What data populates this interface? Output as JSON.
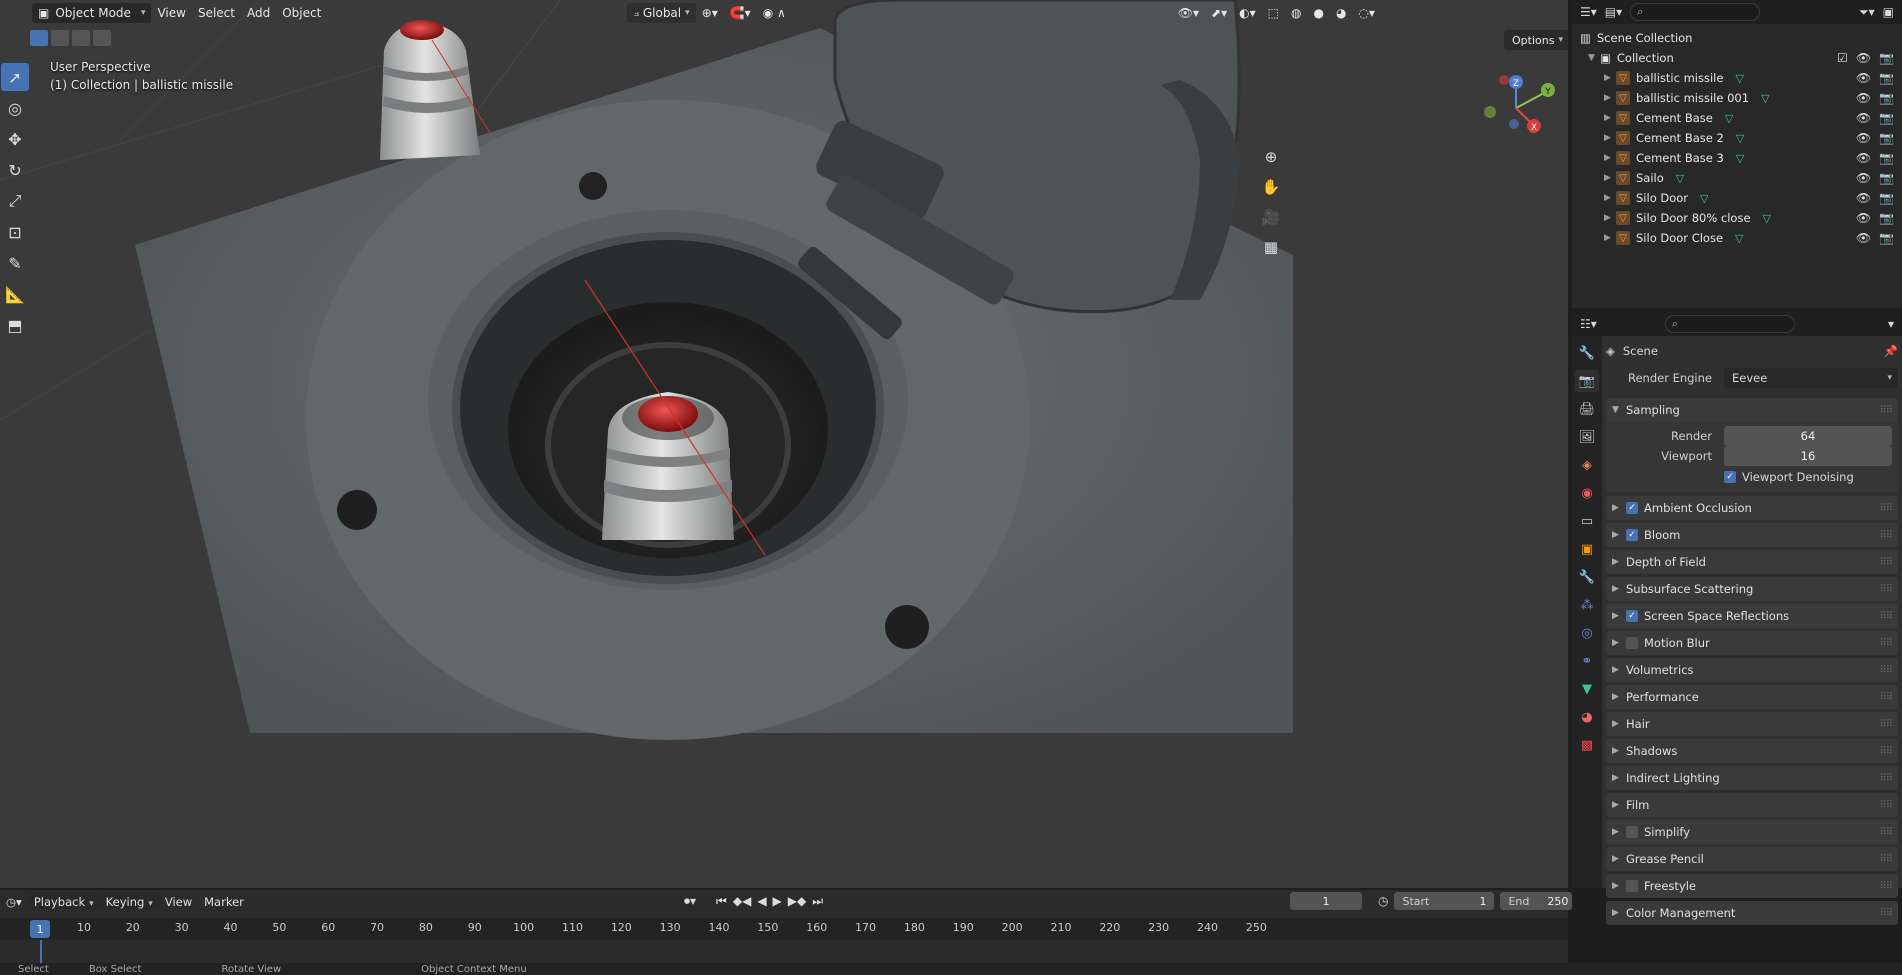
{
  "viewport_header": {
    "mode": "Object Mode",
    "menus": [
      "View",
      "Select",
      "Add",
      "Object"
    ],
    "orientation": "Global",
    "options_label": "Options"
  },
  "viewport_overlay": {
    "perspective": "User Perspective",
    "collection_info": "(1) Collection | ballistic missile"
  },
  "gizmo": {
    "x": "X",
    "y": "Y",
    "z": "Z"
  },
  "outliner": {
    "scene_collection": "Scene Collection",
    "collection": "Collection",
    "items": [
      "ballistic missile",
      "ballistic missile 001",
      "Cement  Base",
      "Cement  Base 2",
      "Cement  Base 3",
      "Sailo",
      "Silo Door",
      "Silo Door 80% close",
      "Silo Door Close"
    ]
  },
  "properties": {
    "context": "Scene",
    "render_engine_label": "Render Engine",
    "render_engine_value": "Eevee",
    "sampling": {
      "title": "Sampling",
      "render_label": "Render",
      "render_value": "64",
      "viewport_label": "Viewport",
      "viewport_value": "16",
      "denoise_label": "Viewport Denoising"
    },
    "panels": [
      {
        "label": "Ambient Occlusion",
        "checkbox": true,
        "checked": true
      },
      {
        "label": "Bloom",
        "checkbox": true,
        "checked": true
      },
      {
        "label": "Depth of Field",
        "checkbox": false
      },
      {
        "label": "Subsurface Scattering",
        "checkbox": false
      },
      {
        "label": "Screen Space Reflections",
        "checkbox": true,
        "checked": true
      },
      {
        "label": "Motion Blur",
        "checkbox": true,
        "checked": false
      },
      {
        "label": "Volumetrics",
        "checkbox": false
      },
      {
        "label": "Performance",
        "checkbox": false
      },
      {
        "label": "Hair",
        "checkbox": false
      },
      {
        "label": "Shadows",
        "checkbox": false
      },
      {
        "label": "Indirect Lighting",
        "checkbox": false
      },
      {
        "label": "Film",
        "checkbox": false
      },
      {
        "label": "Simplify",
        "checkbox": true,
        "checked": false
      },
      {
        "label": "Grease Pencil",
        "checkbox": false
      },
      {
        "label": "Freestyle",
        "checkbox": true,
        "checked": false
      },
      {
        "label": "Color Management",
        "checkbox": false
      }
    ]
  },
  "timeline": {
    "menus": [
      "Playback",
      "Keying",
      "View",
      "Marker"
    ],
    "current_frame": "1",
    "frame_field": "1",
    "start_label": "Start",
    "start_value": "1",
    "end_label": "End",
    "end_value": "250",
    "ticks": [
      "10",
      "20",
      "30",
      "40",
      "50",
      "60",
      "70",
      "80",
      "90",
      "100",
      "110",
      "120",
      "130",
      "140",
      "150",
      "160",
      "170",
      "180",
      "190",
      "200",
      "210",
      "220",
      "230",
      "240",
      "250"
    ]
  },
  "statusbar": {
    "items": [
      "Select",
      "Box Select",
      "Rotate View",
      "Object Context Menu"
    ]
  }
}
